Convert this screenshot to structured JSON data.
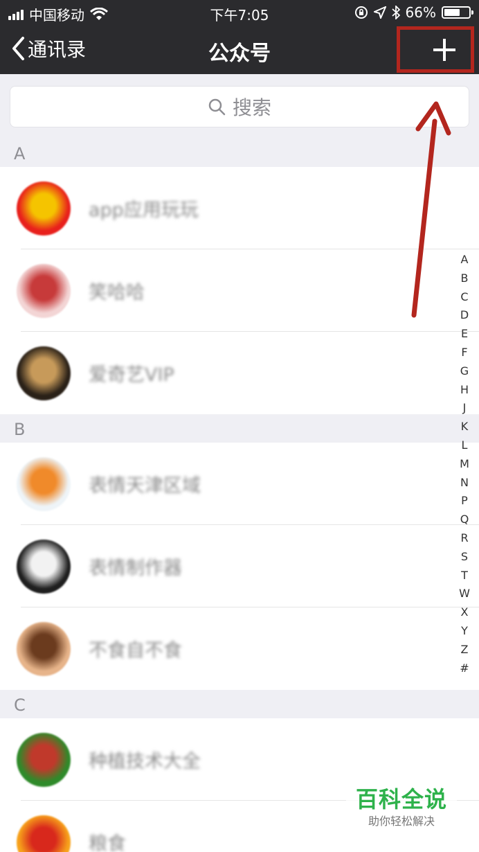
{
  "status_bar": {
    "carrier": "中国移动",
    "time": "下午7:05",
    "battery_percent": "66%",
    "battery_level": 0.66,
    "icons": [
      "signal-icon",
      "wifi-icon",
      "orientation-lock-icon",
      "location-icon",
      "bluetooth-icon",
      "battery-icon"
    ]
  },
  "nav": {
    "back_label": "通讯录",
    "title": "公众号",
    "add_icon": "plus-icon"
  },
  "search": {
    "placeholder": "搜索",
    "icon": "search-icon"
  },
  "sections": [
    {
      "letter": "A",
      "items": [
        {
          "name": "app应用玩玩",
          "avatar_colors": [
            "#e8201c",
            "#f5c400"
          ]
        },
        {
          "name": "笑哈哈",
          "avatar_colors": [
            "#f3d5d5",
            "#c73a3a"
          ]
        },
        {
          "name": "爱奇艺VIP",
          "avatar_colors": [
            "#2a2118",
            "#c79a5a"
          ]
        }
      ]
    },
    {
      "letter": "B",
      "items": [
        {
          "name": "表情天津区域",
          "avatar_colors": [
            "#eef4f8",
            "#f08a2a"
          ]
        },
        {
          "name": "表情制作器",
          "avatar_colors": [
            "#1f1f1f",
            "#f2f2f2"
          ]
        },
        {
          "name": "不食自不食",
          "avatar_colors": [
            "#e7b48a",
            "#6b3b1e"
          ]
        }
      ]
    },
    {
      "letter": "C",
      "items": [
        {
          "name": "种植技术大全",
          "avatar_colors": [
            "#2f8a2a",
            "#c0392b"
          ]
        },
        {
          "name": "粮食",
          "avatar_colors": [
            "#f7a21b",
            "#d8281c"
          ]
        }
      ]
    }
  ],
  "index_letters": [
    "A",
    "B",
    "C",
    "D",
    "E",
    "F",
    "G",
    "H",
    "J",
    "K",
    "L",
    "M",
    "N",
    "P",
    "Q",
    "R",
    "S",
    "T",
    "W",
    "X",
    "Y",
    "Z",
    "#"
  ],
  "watermark": {
    "brand": "百科全说",
    "slogan": "助你轻松解决"
  },
  "colors": {
    "header_bg": "#2b2b2e",
    "annotation_red": "#b3261e",
    "watermark_green": "#2eb24b"
  }
}
